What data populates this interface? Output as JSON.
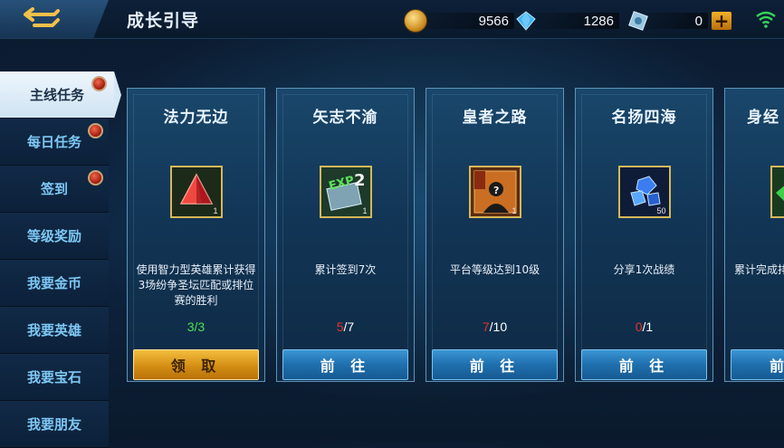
{
  "header": {
    "title": "成长引导",
    "gold": "9566",
    "diamonds": "1286",
    "tickets": "0",
    "add_label": "+"
  },
  "sidebar": {
    "items": [
      {
        "label": "主线任务",
        "active": true,
        "dot": true
      },
      {
        "label": "每日任务",
        "active": false,
        "dot": true
      },
      {
        "label": "签到",
        "active": false,
        "dot": true
      },
      {
        "label": "等级奖励",
        "active": false,
        "dot": false
      },
      {
        "label": "我要金币",
        "active": false,
        "dot": false
      },
      {
        "label": "我要英雄",
        "active": false,
        "dot": false
      },
      {
        "label": "我要宝石",
        "active": false,
        "dot": false
      },
      {
        "label": "我要朋友",
        "active": false,
        "dot": false
      }
    ]
  },
  "cards": [
    {
      "title": "法力无边",
      "icon": "red-crystal-icon",
      "count": "1",
      "desc": "使用智力型英雄累计获得3场纷争圣坛匹配或排位赛的胜利",
      "progress_current": "3",
      "progress_total": "/3",
      "progress_color": "#4ee04e",
      "total_color": "#4ee04e",
      "button": "领 取",
      "button_style": "gold"
    },
    {
      "title": "矢志不渝",
      "icon": "exp-card-icon",
      "count": "1",
      "desc": "累计签到7次",
      "progress_current": "5",
      "progress_total": "/7",
      "progress_color": "#e2342a",
      "total_color": "#ffffff",
      "button": "前 往",
      "button_style": "blue"
    },
    {
      "title": "皇者之路",
      "icon": "contract-card-icon",
      "count": "1",
      "desc": "平台等级达到10级",
      "progress_current": "7",
      "progress_total": "/10",
      "progress_color": "#e2342a",
      "total_color": "#ffffff",
      "button": "前 往",
      "button_style": "blue"
    },
    {
      "title": "名扬四海",
      "icon": "blue-diamond-icon",
      "count": "50",
      "desc": "分享1次战绩",
      "progress_current": "0",
      "progress_total": "/1",
      "progress_color": "#e2342a",
      "total_color": "#ffffff",
      "button": "前 往",
      "button_style": "blue"
    },
    {
      "title": "身经",
      "icon": "green-crystal-icon",
      "count": "",
      "desc": "累计完成排",
      "progress_current": "",
      "progress_total": "",
      "progress_color": "#e2342a",
      "total_color": "#ffffff",
      "button": "前",
      "button_style": "blue"
    }
  ],
  "colors": {
    "accent_blue": "#1f6fae",
    "accent_gold": "#d48e14",
    "sidebar_text": "#7ec8f5",
    "progress_done": "#4ee04e",
    "progress_todo": "#e2342a"
  }
}
